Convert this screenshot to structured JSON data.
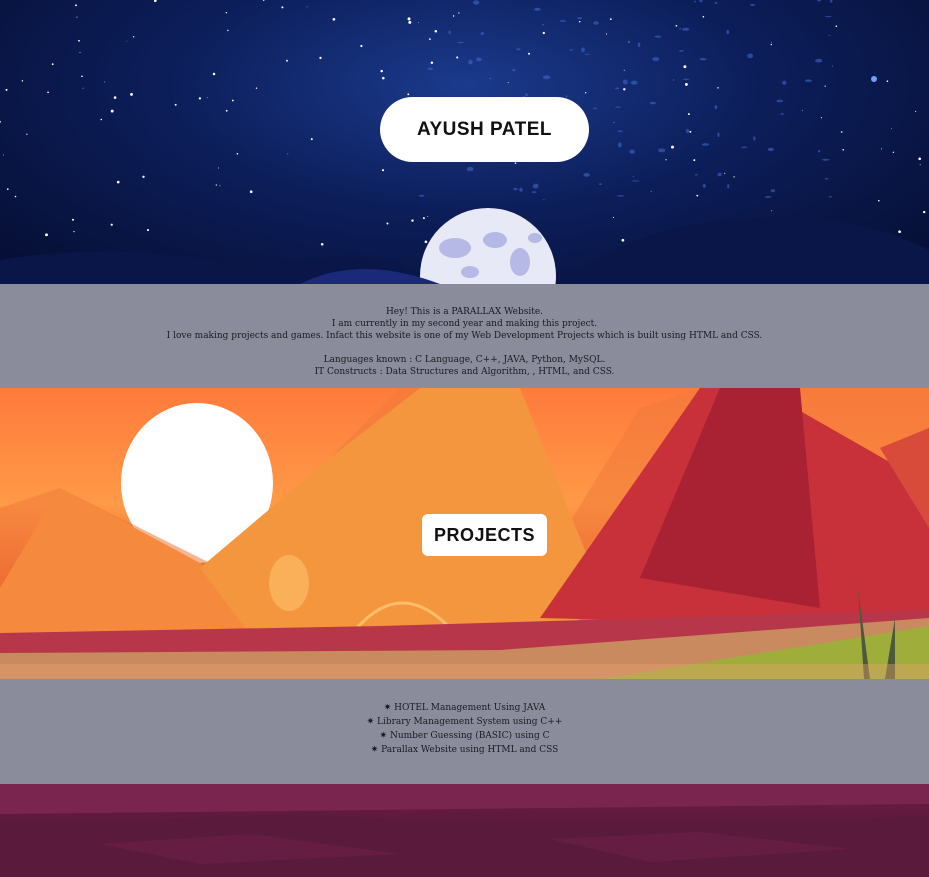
{
  "hero": {
    "title": "AYUSH PATEL"
  },
  "about": {
    "lines": [
      "Hey! This is a PARALLAX Website.",
      "I am currently in my second year and making this project.",
      "I love making projects and games. Infact this website is one of my Web Development Projects which is built using HTML and CSS."
    ],
    "languages": "Languages known : C Language, C++, JAVA, Python, MySQL.",
    "constructs": "IT Constructs : Data Structures and Algorithm, , HTML, and CSS."
  },
  "projects": {
    "title": "PROJECTS",
    "bullet": "✷",
    "items": [
      "HOTEL Management Using JAVA",
      "Library Management System using C++",
      "Number Guessing (BASIC) using C",
      "Parallax Website using HTML and CSS"
    ]
  },
  "colors": {
    "sky_night": "#0c1e5a",
    "band_gray": "#8b8c9b",
    "sunset_orange": "#ff8a40",
    "mountain_red": "#c42a35",
    "footer_purple": "#5a1a3a"
  }
}
